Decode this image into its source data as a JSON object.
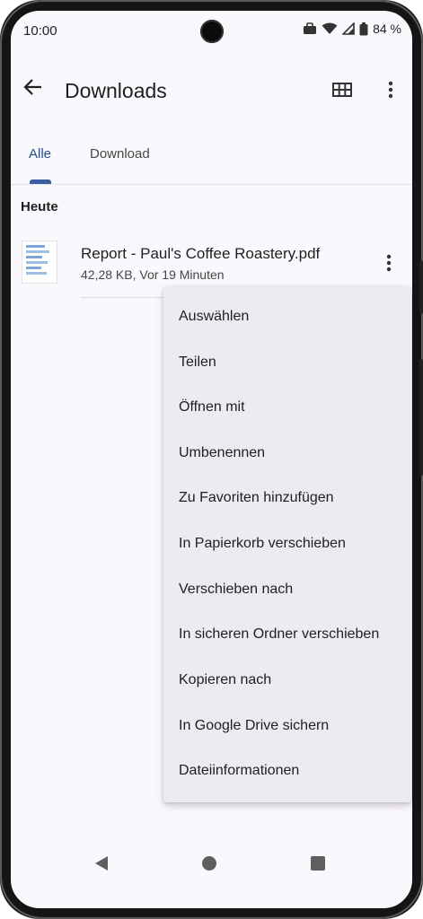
{
  "status_bar": {
    "time": "10:00",
    "battery": "84 %",
    "icons": [
      "briefcase-icon",
      "wifi-icon",
      "signal-icon",
      "battery-icon"
    ]
  },
  "app_bar": {
    "title": "Downloads",
    "back_icon": "arrow-back-icon",
    "grid_icon": "grid-view-icon",
    "more_icon": "more-vert-icon"
  },
  "tabs": [
    {
      "label": "Alle",
      "active": true
    },
    {
      "label": "Download",
      "active": false
    }
  ],
  "section": {
    "header": "Heute"
  },
  "file": {
    "name": "Report - Paul's Coffee Roastery.pdf",
    "meta": "42,28 KB, Vor 19 Minuten",
    "thumb_icon": "pdf-thumbnail-icon"
  },
  "context_menu": {
    "items": [
      "Auswählen",
      "Teilen",
      "Öffnen mit",
      "Umbenennen",
      "Zu Favoriten hinzufügen",
      "In Papierkorb verschieben",
      "Verschieben nach",
      "In sicheren Ordner verschieben",
      "Kopieren nach",
      "In Google Drive sichern",
      "Dateiinformationen"
    ]
  },
  "nav_bar": {
    "icons": [
      "nav-back-icon",
      "nav-home-icon",
      "nav-recents-icon"
    ]
  },
  "colors": {
    "accent": "#3b5f9e",
    "menu_bg": "#ecebf1",
    "background": "#fbf8fd"
  }
}
